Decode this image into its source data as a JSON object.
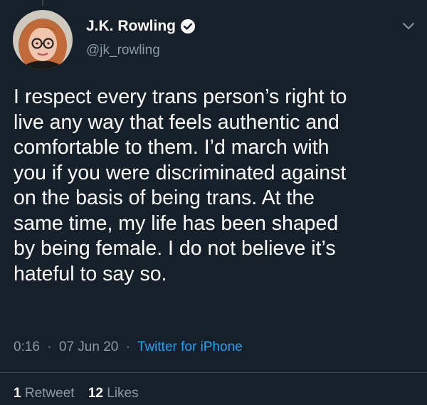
{
  "tweet": {
    "author": {
      "display_name": "J.K. Rowling",
      "handle": "@jk_rowling",
      "verified": true
    },
    "text": "I respect every trans person’s right to\nlive any way that feels authentic and\ncomfortable to them. I’d march with\nyou if you were discriminated against\non the basis of being trans. At the\nsame time, my life has been shaped\nby being female. I do not believe it’s\nhateful to say so.",
    "time": "0:16",
    "separator": "·",
    "date": "07 Jun 20",
    "source": "Twitter for iPhone",
    "stats": {
      "retweets_count": "1",
      "retweets_label": "Retweet",
      "likes_count": "12",
      "likes_label": "Likes"
    }
  },
  "icons": {
    "verified": "verified-badge-icon",
    "more": "chevron-down-icon",
    "avatar": "profile-photo"
  },
  "colors": {
    "background": "#15202b",
    "primary_text": "#ffffff",
    "secondary_text": "#8899a6",
    "link": "#1da1f2",
    "divider": "#38444d"
  }
}
